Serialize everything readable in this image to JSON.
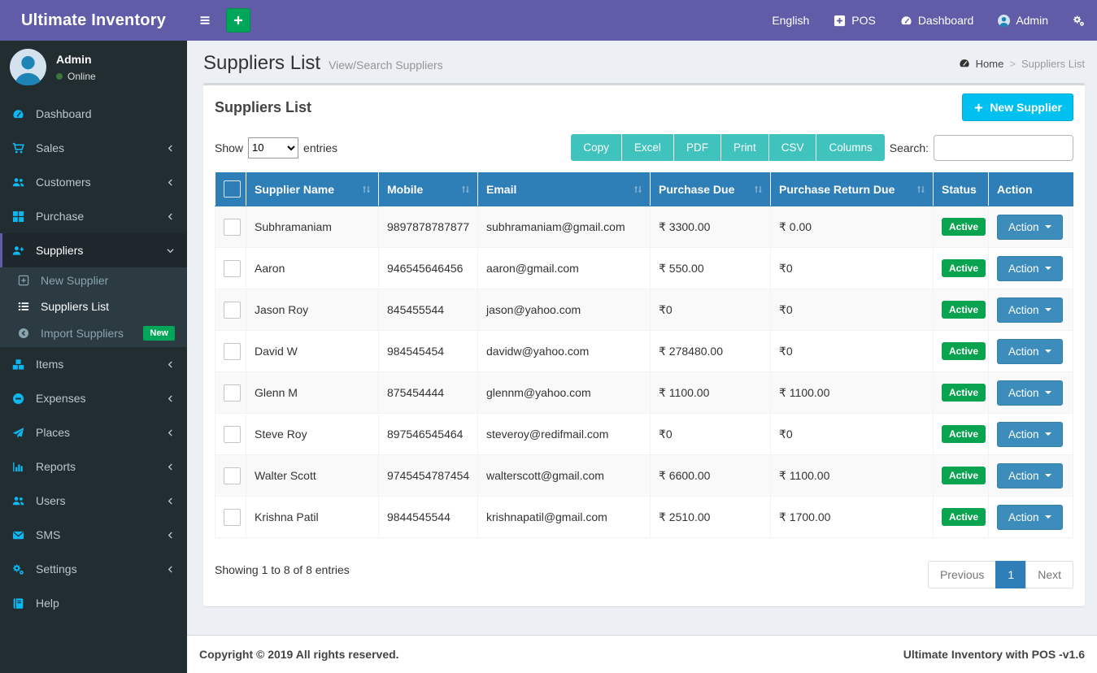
{
  "navbar": {
    "brand": "Ultimate Inventory",
    "language": "English",
    "pos_label": "POS",
    "dashboard_label": "Dashboard",
    "user_name": "Admin"
  },
  "sidebar": {
    "user": {
      "name": "Admin",
      "status": "Online"
    },
    "items": [
      {
        "label": "Dashboard",
        "icon": "tachometer"
      },
      {
        "label": "Sales",
        "icon": "cart",
        "chevron": true
      },
      {
        "label": "Customers",
        "icon": "users",
        "chevron": true
      },
      {
        "label": "Purchase",
        "icon": "grid",
        "chevron": true
      },
      {
        "label": "Suppliers",
        "icon": "user-plus",
        "active": true,
        "expanded": true,
        "children": [
          {
            "label": "New Supplier",
            "icon": "plus-square-o"
          },
          {
            "label": "Suppliers List",
            "icon": "list",
            "active": true
          },
          {
            "label": "Import Suppliers",
            "icon": "arrow-circle-left",
            "badge": "New"
          }
        ]
      },
      {
        "label": "Items",
        "icon": "cubes",
        "chevron": true
      },
      {
        "label": "Expenses",
        "icon": "minus-circle",
        "chevron": true
      },
      {
        "label": "Places",
        "icon": "send",
        "chevron": true
      },
      {
        "label": "Reports",
        "icon": "bar-chart",
        "chevron": true
      },
      {
        "label": "Users",
        "icon": "users",
        "chevron": true
      },
      {
        "label": "SMS",
        "icon": "envelope",
        "chevron": true
      },
      {
        "label": "Settings",
        "icon": "cogs",
        "chevron": true
      },
      {
        "label": "Help",
        "icon": "book"
      }
    ]
  },
  "page": {
    "title": "Suppliers List",
    "subtitle": "View/Search Suppliers",
    "breadcrumb_home": "Home",
    "breadcrumb_current": "Suppliers List"
  },
  "card": {
    "title": "Suppliers List",
    "new_button": "New Supplier",
    "show_label": "Show",
    "page_length": "10",
    "entries_label": "entries",
    "export_buttons": [
      "Copy",
      "Excel",
      "PDF",
      "Print",
      "CSV",
      "Columns"
    ],
    "search_label": "Search:",
    "table": {
      "columns": [
        {
          "label": "Supplier Name",
          "sortable": true
        },
        {
          "label": "Mobile",
          "sortable": true
        },
        {
          "label": "Email",
          "sortable": true
        },
        {
          "label": "Purchase Due",
          "sortable": true
        },
        {
          "label": "Purchase Return Due",
          "sortable": true
        },
        {
          "label": "Status",
          "sortable": false
        },
        {
          "label": "Action",
          "sortable": false
        }
      ],
      "rows": [
        {
          "name": "Subhramaniam",
          "mobile": "9897878787877",
          "email": "subhramaniam@gmail.com",
          "purchase_due": "₹ 3300.00",
          "purchase_return_due": "₹ 0.00",
          "status": "Active",
          "action": "Action"
        },
        {
          "name": "Aaron",
          "mobile": "946545646456",
          "email": "aaron@gmail.com",
          "purchase_due": "₹ 550.00",
          "purchase_return_due": "₹0",
          "status": "Active",
          "action": "Action"
        },
        {
          "name": "Jason Roy",
          "mobile": "845455544",
          "email": "jason@yahoo.com",
          "purchase_due": "₹0",
          "purchase_return_due": "₹0",
          "status": "Active",
          "action": "Action"
        },
        {
          "name": "David W",
          "mobile": "984545454",
          "email": "davidw@yahoo.com",
          "purchase_due": "₹ 278480.00",
          "purchase_return_due": "₹0",
          "status": "Active",
          "action": "Action"
        },
        {
          "name": "Glenn M",
          "mobile": "875454444",
          "email": "glennm@yahoo.com",
          "purchase_due": "₹ 1100.00",
          "purchase_return_due": "₹ 1100.00",
          "status": "Active",
          "action": "Action"
        },
        {
          "name": "Steve Roy",
          "mobile": "897546545464",
          "email": "steveroy@redifmail.com",
          "purchase_due": "₹0",
          "purchase_return_due": "₹0",
          "status": "Active",
          "action": "Action"
        },
        {
          "name": "Walter Scott",
          "mobile": "9745454787454",
          "email": "walterscott@gmail.com",
          "purchase_due": "₹ 6600.00",
          "purchase_return_due": "₹ 1100.00",
          "status": "Active",
          "action": "Action"
        },
        {
          "name": "Krishna Patil",
          "mobile": "9844545544",
          "email": "krishnapatil@gmail.com",
          "purchase_due": "₹ 2510.00",
          "purchase_return_due": "₹ 1700.00",
          "status": "Active",
          "action": "Action"
        }
      ]
    },
    "info": "Showing 1 to 8 of 8 entries",
    "pagination": {
      "previous": "Previous",
      "current": "1",
      "next": "Next"
    }
  },
  "footer": {
    "left": "Copyright © 2019 All rights reserved.",
    "right": "Ultimate Inventory with POS -v1.6"
  },
  "colors": {
    "navbar": "#605ca8",
    "sidebar": "#222d32",
    "sidebar_submenu": "#2c3b41",
    "sidebar_icon": "#0db8f0",
    "table_header": "#2e7eb8",
    "action_button": "#3c8dbc",
    "new_supplier_button": "#00c0ef",
    "export_button": "#3fc3bc",
    "green": "#00a65a",
    "active_badge": "#0aa450",
    "page_background": "#ecf0f5"
  }
}
